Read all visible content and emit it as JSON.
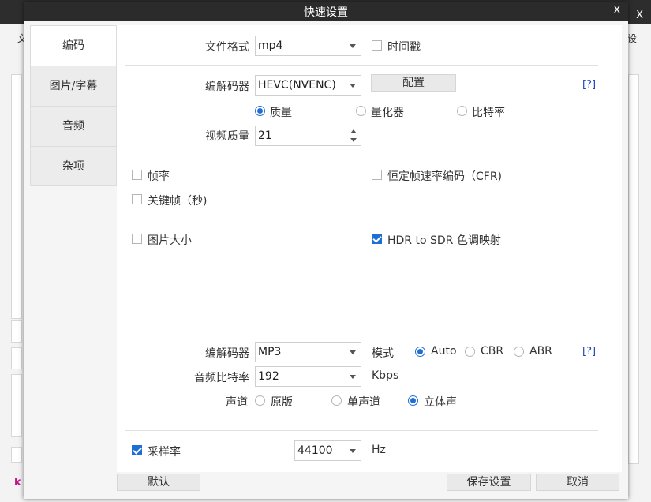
{
  "background": {
    "close_label": "X",
    "menu_left": "文",
    "menu_right": "设",
    "logo_text": "k"
  },
  "dialog": {
    "title": "快速设置",
    "close_label": "x"
  },
  "sidebar": {
    "items": [
      {
        "label": "编码",
        "active": true
      },
      {
        "label": "图片/字幕",
        "active": false
      },
      {
        "label": "音频",
        "active": false
      },
      {
        "label": "杂项",
        "active": false
      }
    ]
  },
  "video": {
    "format_label": "文件格式",
    "format_value": "mp4",
    "timestamp_label": "时间戳",
    "timestamp_checked": false,
    "codec_label": "编解码器",
    "codec_value": "HEVC(NVENC)",
    "config_button": "配置",
    "help_link": "[?]",
    "rate_modes": [
      {
        "label": "质量",
        "selected": true
      },
      {
        "label": "量化器",
        "selected": false
      },
      {
        "label": "比特率",
        "selected": false
      }
    ],
    "quality_label": "视频质量",
    "quality_value": "21"
  },
  "framerate": {
    "framerate_label": "帧率",
    "framerate_checked": false,
    "cfr_label": "恒定帧速率编码（CFR)",
    "cfr_checked": false,
    "keyframe_label": "关键帧（秒)",
    "keyframe_checked": false
  },
  "picture": {
    "size_label": "图片大小",
    "size_checked": false,
    "hdr_label": "HDR to SDR 色调映射",
    "hdr_checked": true
  },
  "audio": {
    "codec_label": "编解码器",
    "codec_value": "MP3",
    "mode_label": "模式",
    "modes": [
      {
        "label": "Auto",
        "selected": true
      },
      {
        "label": "CBR",
        "selected": false
      },
      {
        "label": "ABR",
        "selected": false
      }
    ],
    "help_link": "[?]",
    "bitrate_label": "音频比特率",
    "bitrate_value": "192",
    "bitrate_unit": "Kbps",
    "channel_label": "声道",
    "channels": [
      {
        "label": "原版",
        "selected": false
      },
      {
        "label": "单声道",
        "selected": false
      },
      {
        "label": "立体声",
        "selected": true
      }
    ],
    "samplerate_label": "采样率",
    "samplerate_checked": true,
    "samplerate_value": "44100",
    "samplerate_unit": "Hz"
  },
  "footer": {
    "default_button": "默认",
    "save_button": "保存设置",
    "cancel_button": "取消"
  },
  "colors": {
    "accent": "#1e6ed6",
    "link": "#1b45b7",
    "titlebar": "#2b2b2b",
    "logo": "#c2138a"
  }
}
